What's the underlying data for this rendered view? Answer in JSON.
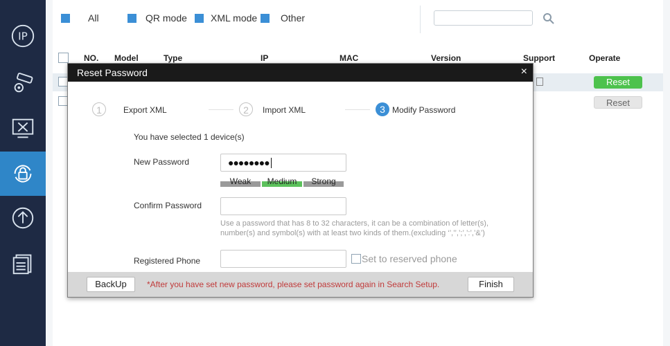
{
  "sidebar": {
    "items": [
      {
        "icon": "ip-icon"
      },
      {
        "icon": "camera-settings-icon"
      },
      {
        "icon": "system-tools-icon"
      },
      {
        "icon": "password-reset-icon"
      },
      {
        "icon": "upgrade-icon"
      },
      {
        "icon": "document-icon"
      }
    ],
    "active_index": 3,
    "active_color": "#2f86c8",
    "bg_color": "#1e2a44"
  },
  "filters": {
    "all": "All",
    "qr_mode": "QR mode",
    "xml_mode": "XML mode",
    "other": "Other"
  },
  "search": {
    "value": "",
    "placeholder": ""
  },
  "table": {
    "columns": [
      "NO.",
      "Model",
      "Type",
      "IP",
      "MAC",
      "Version",
      "Support",
      "Operate"
    ],
    "rows": [
      {
        "operate": "Reset"
      },
      {
        "operate": "Reset"
      }
    ]
  },
  "modal": {
    "title": "Reset Password",
    "close": "×",
    "steps": [
      {
        "num": "1",
        "label": "Export XML"
      },
      {
        "num": "2",
        "label": "Import XML"
      },
      {
        "num": "3",
        "label": "Modify Password"
      }
    ],
    "selected_text": "You have selected 1 device(s)",
    "new_password_label": "New Password",
    "new_password_value": "●●●●●●●●",
    "strength": {
      "weak": "Weak",
      "medium": "Medium",
      "strong": "Strong"
    },
    "confirm_password_label": "Confirm Password",
    "confirm_password_value": "",
    "hint": "Use a password that has 8 to 32 characters, it can be a combination of letter(s), number(s) and symbol(s) with at least two kinds of them.(excluding ‘’,’’,’;’,’:’,’&’)",
    "phone_label": "Registered Phone",
    "phone_value": "",
    "reserve_label": "Set to reserved phone",
    "backup_label": "BackUp",
    "warning": "*After you have set new password, please set password again in Search Setup.",
    "finish_label": "Finish"
  },
  "colors": {
    "accent": "#3b8fd6",
    "reset_green": "#4dc24d",
    "warning_red": "#c03a3a"
  }
}
